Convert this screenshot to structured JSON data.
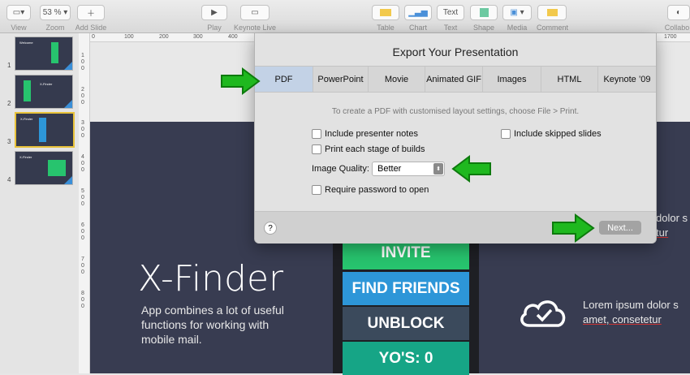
{
  "toolbar": {
    "view": "View",
    "zoom": "Zoom",
    "zoom_value": "53 %",
    "add_slide": "Add Slide",
    "play": "Play",
    "keynote_live": "Keynote Live",
    "table": "Table",
    "chart": "Chart",
    "text": "Text",
    "text_btn": "Text",
    "shape": "Shape",
    "media": "Media",
    "comment": "Comment",
    "collab": "Collabo"
  },
  "slides": [
    {
      "num": "1",
      "title": "Welcome"
    },
    {
      "num": "2",
      "title": "X-Finder"
    },
    {
      "num": "3",
      "title": "X-Finder"
    },
    {
      "num": "4",
      "title": "X-Finder"
    }
  ],
  "ruler": {
    "h": [
      "0",
      "100",
      "200",
      "300",
      "400",
      "1700"
    ],
    "v": [
      "1",
      "0",
      "0",
      "2",
      "0",
      "0",
      "3",
      "0",
      "0",
      "4",
      "0",
      "0",
      "5",
      "0",
      "0",
      "6",
      "0",
      "0",
      "7",
      "0",
      "0",
      "8",
      "0",
      "0"
    ]
  },
  "slide": {
    "title": "X-Finder",
    "description": "App combines a lot of useful functions for working with mobile mail.",
    "buttons": [
      "INVITE",
      "FIND FRIENDS",
      "UNBLOCK",
      "YO'S: 0"
    ],
    "lorem1a": "dolor s",
    "lorem1b": "tur",
    "lorem2a": "Lorem ipsum dolor s",
    "lorem2b": "amet, consetetur"
  },
  "dialog": {
    "title": "Export Your Presentation",
    "tabs": [
      "PDF",
      "PowerPoint",
      "Movie",
      "Animated GIF",
      "Images",
      "HTML",
      "Keynote ’09"
    ],
    "info": "To create a PDF with customised layout settings, choose File > Print.",
    "opt_notes": "Include presenter notes",
    "opt_skipped": "Include skipped slides",
    "opt_builds": "Print each stage of builds",
    "quality_label": "Image Quality:",
    "quality_value": "Better",
    "opt_password": "Require password to open",
    "help": "?",
    "next": "Next..."
  },
  "colors": {
    "slide_bg": "#383c51",
    "invite": "#27c46e",
    "find_friends": "#2d96d8",
    "unblock": "#3b4a5c",
    "yos": "#16a586",
    "arrow": "#1fb81f",
    "selected_tab": "#c3d2e6"
  }
}
